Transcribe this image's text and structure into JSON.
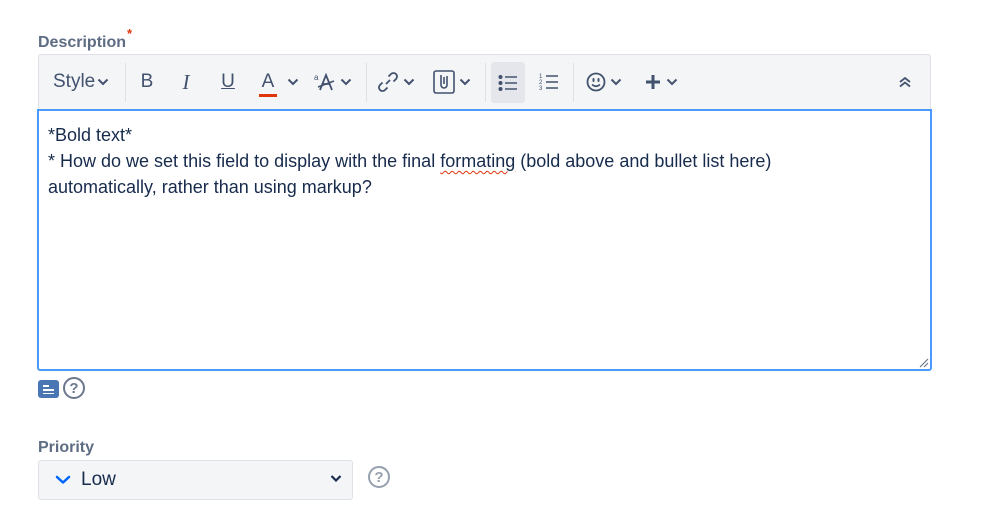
{
  "description": {
    "label": "Description",
    "required_marker": "*",
    "toolbar": {
      "style_label": "Style",
      "bold_glyph": "B",
      "italic_glyph": "I",
      "underline_glyph": "U",
      "text_color_glyph": "A",
      "text_color_underline": "#de350b"
    },
    "content": {
      "line1": "*Bold text*",
      "line2_before": "* How do we set this field to display with the final ",
      "line2_misspelled": "formating",
      "line2_after": " (bold above and bullet list here)",
      "line3": "automatically, rather than using markup?"
    },
    "help_glyph": "?"
  },
  "priority": {
    "label": "Priority",
    "selected": "Low",
    "priority_icon_color": "#0065ff",
    "help_glyph": "?"
  },
  "colors": {
    "focus_border": "#4c9aff",
    "label": "#5e6c84",
    "text": "#172b4d",
    "toolbar_bg": "#f4f5f7"
  }
}
